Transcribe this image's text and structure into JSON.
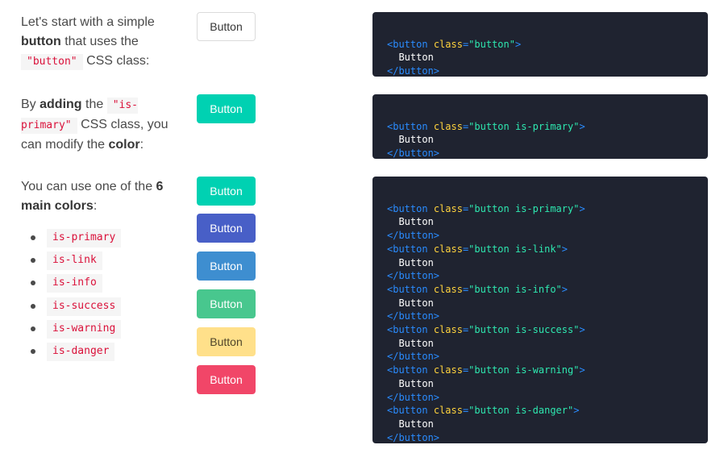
{
  "section1": {
    "desc_part1": "Let's start with a simple ",
    "desc_bold": "button",
    "desc_part2": " that uses the ",
    "desc_code": "\"button\"",
    "desc_part3": " CSS class:",
    "button_label": "Button",
    "code": {
      "open_tag": "<button",
      "attr": "class",
      "eq": "=",
      "value": "\"button\"",
      "close": ">",
      "text": "Button",
      "end_tag": "</button>"
    }
  },
  "section2": {
    "desc_part1": "By ",
    "desc_bold": "adding",
    "desc_part2": " the ",
    "desc_code": "\"is-primary\"",
    "desc_part3": " CSS class, you can modify the ",
    "desc_bold2": "color",
    "desc_part4": ":",
    "button_label": "Button",
    "code": {
      "open_tag": "<button",
      "attr": "class",
      "eq": "=",
      "value": "\"button is-primary\"",
      "close": ">",
      "text": "Button",
      "end_tag": "</button>"
    }
  },
  "section3": {
    "desc_part1": "You can use one of the ",
    "desc_bold": "6 main colors",
    "desc_part2": ":",
    "color_list": [
      "is-primary",
      "is-link",
      "is-info",
      "is-success",
      "is-warning",
      "is-danger"
    ],
    "buttons": [
      {
        "label": "Button",
        "class": "is-primary"
      },
      {
        "label": "Button",
        "class": "is-link"
      },
      {
        "label": "Button",
        "class": "is-info"
      },
      {
        "label": "Button",
        "class": "is-success"
      },
      {
        "label": "Button",
        "class": "is-warning"
      },
      {
        "label": "Button",
        "class": "is-danger"
      }
    ],
    "code_lines": [
      {
        "value": "\"button is-primary\"",
        "text": "Button"
      },
      {
        "value": "\"button is-link\"",
        "text": "Button"
      },
      {
        "value": "\"button is-info\"",
        "text": "Button"
      },
      {
        "value": "\"button is-success\"",
        "text": "Button"
      },
      {
        "value": "\"button is-warning\"",
        "text": "Button"
      },
      {
        "value": "\"button is-danger\"",
        "text": "Button"
      }
    ],
    "code_common": {
      "open_tag": "<button",
      "attr": "class",
      "eq": "=",
      "close": ">",
      "end_tag": "</button>"
    }
  },
  "colors": {
    "primary": "#00d1b2",
    "link": "#485fc7",
    "info": "#3e8ed0",
    "success": "#48c78e",
    "warning": "#ffe08a",
    "danger": "#f14668",
    "code_bg": "#1f2330"
  }
}
